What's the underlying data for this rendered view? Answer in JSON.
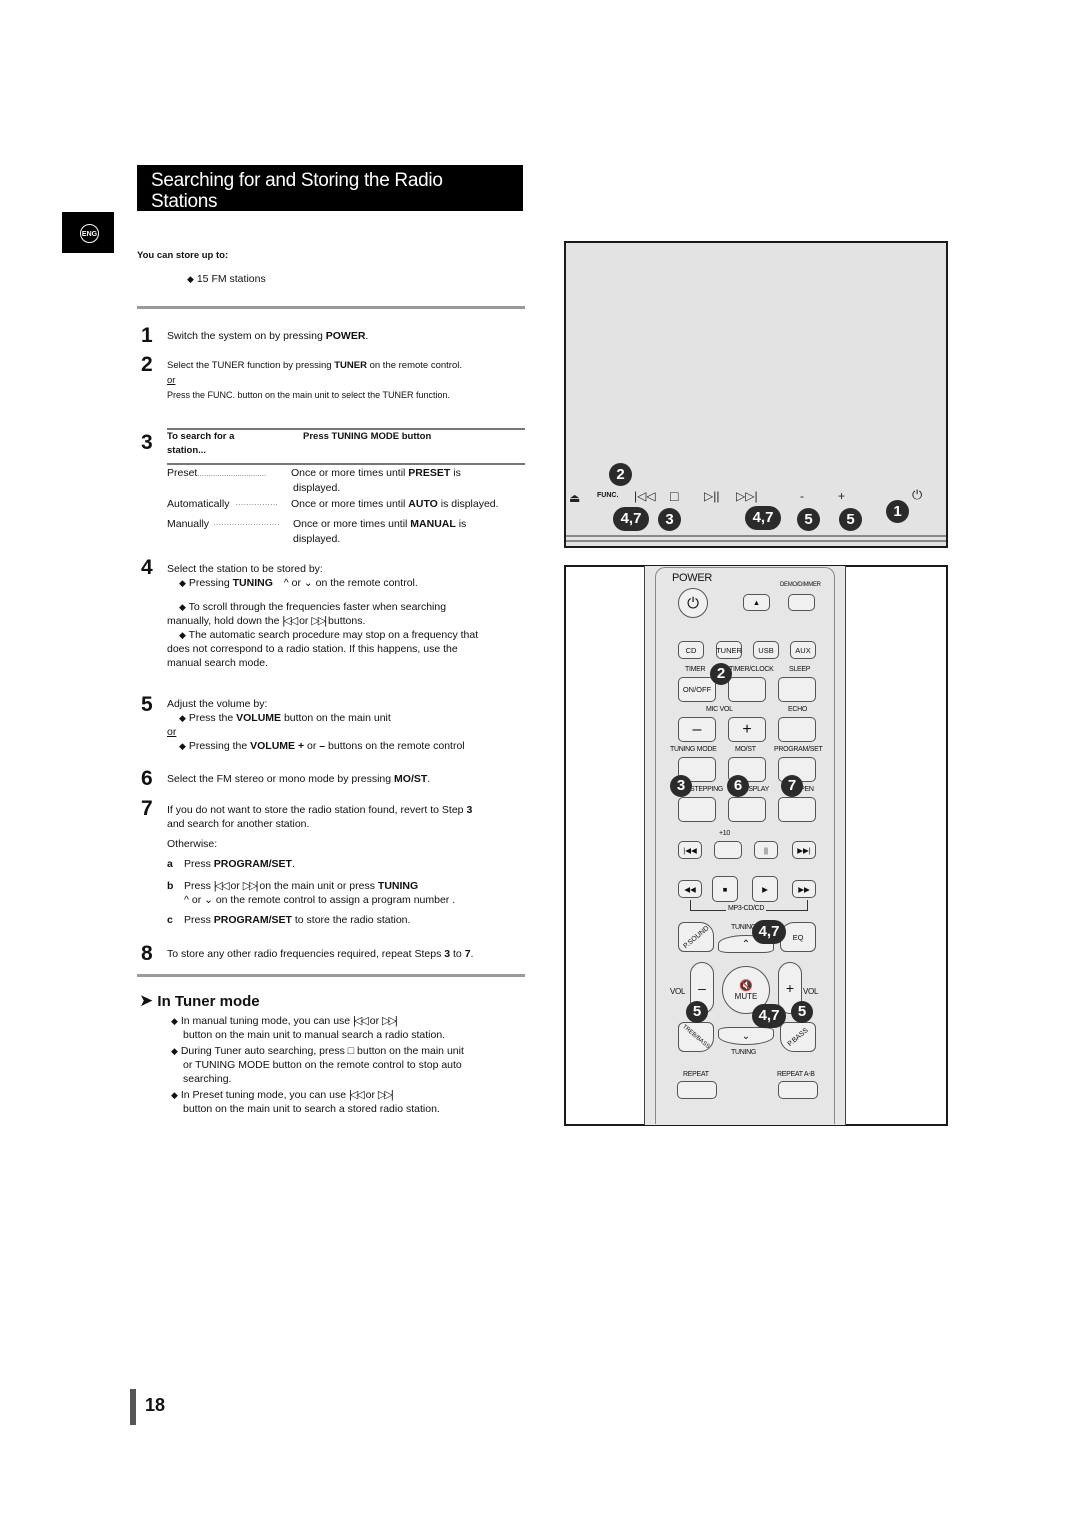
{
  "header": {
    "title_line1": "Searching for and Storing the Radio",
    "title_line2": "Stations",
    "lang_badge": "ENG"
  },
  "intro": {
    "heading": "You can store up to:",
    "bullet": "15 FM stations"
  },
  "steps": {
    "s1": {
      "num": "1",
      "text": "Switch the system on by pressing ",
      "bold": "POWER",
      "tail": "."
    },
    "s2": {
      "num": "2",
      "text": "Select the TUNER function by pressing ",
      "bold": "TUNER",
      "tail": " on the remote control.",
      "or": "or",
      "alt": "Press the FUNC. button on the main unit to select the TUNER function."
    },
    "s3": {
      "num": "3",
      "col1": "To search for a",
      "col1b": "station...",
      "col2": "Press TUNING MODE button",
      "rows": [
        {
          "mode": "Preset",
          "pre": "Once or more times until ",
          "bold": "PRESET",
          "post": " is",
          "cont": "displayed."
        },
        {
          "mode": "Automatically",
          "pre": "Once or more times until ",
          "bold": "AUTO",
          "post": "  is displayed.",
          "cont": ""
        },
        {
          "mode": "Manually",
          "pre": "Once or more times until ",
          "bold": "MANUAL",
          "post": " is",
          "cont": "displayed."
        }
      ]
    },
    "s4": {
      "num": "4",
      "text": "Select the station to be stored by:",
      "b1_pre": "Pressing ",
      "b1_bold": "TUNING",
      "b1_or": " or ",
      "b1_post": " on the remote control.",
      "b2_line1": "To scroll through the frequencies faster when searching",
      "b2_line2_pre": "manually, hold down the ",
      "b2_or": " or ",
      "b2_post": " buttons.",
      "b3_line1": "The automatic search procedure may stop on a frequency that",
      "b3_line2": "does not correspond to a radio station. If this happens, use the",
      "b3_line3": "manual search mode."
    },
    "s5": {
      "num": "5",
      "text": "Adjust the volume by:",
      "b1_pre": "Press the ",
      "b1_bold": "VOLUME",
      "b1_post": " button on the main unit",
      "or": "or",
      "b2_pre": "Pressing the ",
      "b2_bold": "VOLUME +",
      "b2_mid": " or ",
      "b2_bold2": "–",
      "b2_post": " buttons on the remote control"
    },
    "s6": {
      "num": "6",
      "text": "Select the FM stereo or mono mode by pressing ",
      "bold": "MO/ST",
      "tail": "."
    },
    "s7": {
      "num": "7",
      "line1_pre": "If you do not want to store the radio station found, revert to Step ",
      "line1_bold": "3",
      "line2": "and search for another station.",
      "otherwise": "Otherwise:",
      "a_letter": "a",
      "a_pre": "Press ",
      "a_bold": "PROGRAM/SET",
      "a_post": ".",
      "b_letter": "b",
      "b_pre": "Press ",
      "b_or": " or ",
      "b_mid": " on the main unit or press ",
      "b_bold": "TUNING",
      "b_line2_or": " or ",
      "b_line2_post": " on the remote control to assign a program number .",
      "c_letter": "c",
      "c_pre": "Press ",
      "c_bold": "PROGRAM/SET",
      "c_post": " to store the radio station."
    },
    "s8": {
      "num": "8",
      "pre": "To store any other radio frequencies required, repeat Steps ",
      "b1": "3",
      "mid": " to ",
      "b2": "7",
      "post": "."
    }
  },
  "note": {
    "heading": "In Tuner mode",
    "n1_pre": "In manual tuning mode, you can use ",
    "n1_or": " or ",
    "n1_line2": "button on the main unit to manual search a radio station.",
    "n2_pre": "During Tuner auto searching, press ",
    "n2_post": " button on the main unit",
    "n2_line2": "or TUNING MODE button on the remote control to stop auto",
    "n2_line3": "searching.",
    "n3_pre": "In Preset tuning mode, you can use ",
    "n3_or": " or ",
    "n3_line2": "button on the main unit to search a stored radio station."
  },
  "main_unit": {
    "func_label": "FUNC.",
    "callouts": [
      "2",
      "4,7",
      "3",
      "4,7",
      "5",
      "5",
      "1"
    ],
    "icons": [
      "eject-icon",
      "func-icon",
      "prev-icon",
      "stop-icon",
      "play-pause-icon",
      "next-icon",
      "volume-down-icon",
      "volume-up-icon",
      "power-icon"
    ]
  },
  "remote": {
    "power": "POWER",
    "demo": "DEMO/DIMMER",
    "sources": [
      "CD",
      "TUNER",
      "USB",
      "AUX"
    ],
    "timer": "TIMER",
    "timer_clock": "TIMER/CLOCK",
    "sleep": "SLEEP",
    "on_off": "ON/OFF",
    "mic_vol": "MIC VOL",
    "echo": "ECHO",
    "minus": "–",
    "plus": "+",
    "tuning_mode": "TUNING MODE",
    "mo_st": "MO/ST",
    "program_set": "PROGRAM/SET",
    "stepping": "STEPPING",
    "display": "DISPLAY",
    "open": "OPEN",
    "plus10": "+10",
    "mp3cd": "MP3-CD/CD",
    "psound": "P.SOUND",
    "tuning_up": "TUNING",
    "eq": "EQ",
    "vol": "VOL",
    "mute": "MUTE",
    "treb": "TREB/BASS",
    "tuning_down": "TUNING",
    "pbass": "P.BASS",
    "repeat": "REPEAT",
    "repeat_ab": "REPEAT A-B",
    "callouts": {
      "tuner": "2",
      "tuning_mode": "3",
      "mo_st": "6",
      "program": "7",
      "tuning_up": "4,7",
      "vol_minus": "5",
      "tuning_down": "4,7",
      "vol_plus": "5"
    }
  },
  "page_number": "18"
}
